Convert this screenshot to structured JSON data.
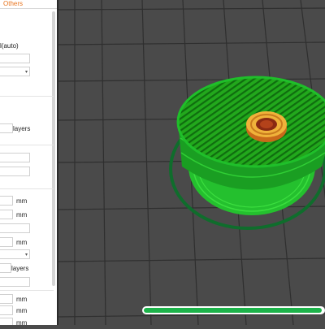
{
  "panel": {
    "tab_label": "Others",
    "support_style_value": "l(auto)",
    "units": {
      "layers": "layers",
      "mm": "mm"
    }
  },
  "viewport": {
    "progress": 0.99
  },
  "colors": {
    "accent": "#e8731c",
    "viewport_bg": "#4a4a4a",
    "model_green": "#22a81c",
    "progress_green": "#1db34a"
  }
}
